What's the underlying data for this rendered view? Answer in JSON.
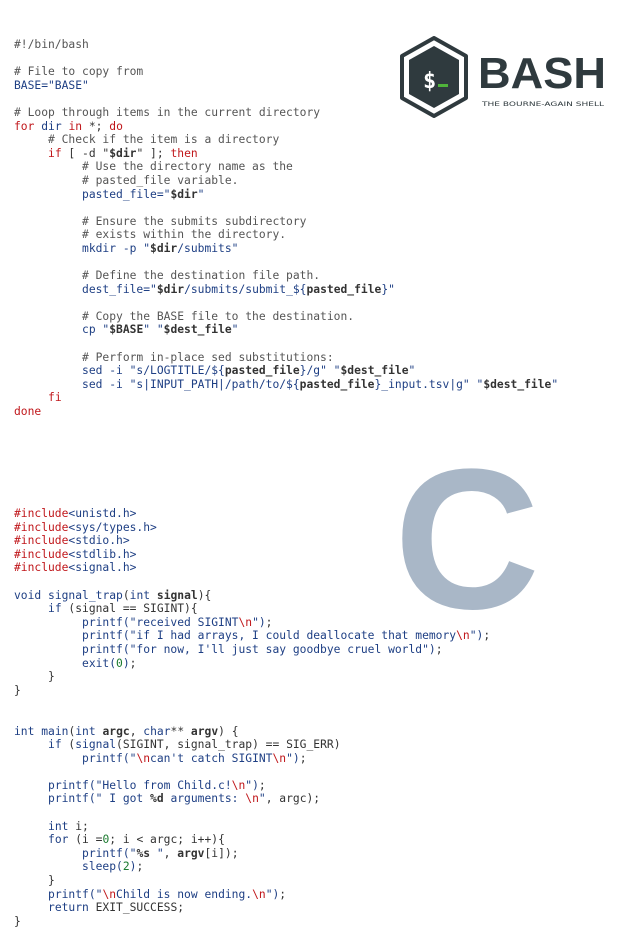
{
  "bash_logo": {
    "wordmark": "BASH",
    "tagline": "THE BOURNE-AGAIN SHELL",
    "prompt_glyph": "$_",
    "color_dark": "#2f3a3e",
    "color_accent": "#4fb33a"
  },
  "c_logo": {
    "letter": "C",
    "color": "#a9b7c7"
  },
  "bash_lines": [
    [
      [
        "cm",
        "#!/bin/bash"
      ]
    ],
    [],
    [
      [
        "cm",
        "# File to copy from"
      ]
    ],
    [
      [
        "st",
        "BASE=\"BASE\""
      ]
    ],
    [],
    [
      [
        "cm",
        "# Loop through items in the current directory"
      ]
    ],
    [
      [
        "kw",
        "for"
      ],
      [
        "pl",
        " "
      ],
      [
        "st",
        "dir"
      ],
      [
        "pl",
        " "
      ],
      [
        "kw",
        "in"
      ],
      [
        "pl",
        " *; "
      ],
      [
        "kw",
        "do"
      ]
    ],
    [
      [
        "pl",
        "     "
      ],
      [
        "cm",
        "# Check if the item is a directory"
      ]
    ],
    [
      [
        "pl",
        "     "
      ],
      [
        "kw",
        "if"
      ],
      [
        "pl",
        " [ -d \""
      ],
      [
        "bo",
        "$dir"
      ],
      [
        "pl",
        "\" ]; "
      ],
      [
        "kw",
        "then"
      ]
    ],
    [
      [
        "pl",
        "          "
      ],
      [
        "cm",
        "# Use the directory name as the"
      ]
    ],
    [
      [
        "pl",
        "          "
      ],
      [
        "cm",
        "# pasted_file variable."
      ]
    ],
    [
      [
        "pl",
        "          "
      ],
      [
        "st",
        "pasted_file=\""
      ],
      [
        "bo",
        "$dir"
      ],
      [
        "st",
        "\""
      ]
    ],
    [],
    [
      [
        "pl",
        "          "
      ],
      [
        "cm",
        "# Ensure the submits subdirectory"
      ]
    ],
    [
      [
        "pl",
        "          "
      ],
      [
        "cm",
        "# exists within the directory."
      ]
    ],
    [
      [
        "pl",
        "          "
      ],
      [
        "st",
        "mkdir -p \""
      ],
      [
        "bo",
        "$dir"
      ],
      [
        "st",
        "/submits\""
      ]
    ],
    [],
    [
      [
        "pl",
        "          "
      ],
      [
        "cm",
        "# Define the destination file path."
      ]
    ],
    [
      [
        "pl",
        "          "
      ],
      [
        "st",
        "dest_file=\""
      ],
      [
        "bo",
        "$dir"
      ],
      [
        "st",
        "/submits/submit_${"
      ],
      [
        "bo",
        "pasted_file"
      ],
      [
        "st",
        "}\""
      ]
    ],
    [],
    [
      [
        "pl",
        "          "
      ],
      [
        "cm",
        "# Copy the BASE file to the destination."
      ]
    ],
    [
      [
        "pl",
        "          "
      ],
      [
        "st",
        "cp \""
      ],
      [
        "bo",
        "$BASE"
      ],
      [
        "st",
        "\" \""
      ],
      [
        "bo",
        "$dest_file"
      ],
      [
        "st",
        "\""
      ]
    ],
    [],
    [
      [
        "pl",
        "          "
      ],
      [
        "cm",
        "# Perform in-place sed substitutions:"
      ]
    ],
    [
      [
        "pl",
        "          "
      ],
      [
        "st",
        "sed -i \"s/LOGTITLE/${"
      ],
      [
        "bo",
        "pasted_file"
      ],
      [
        "st",
        "}/g\" \""
      ],
      [
        "bo",
        "$dest_file"
      ],
      [
        "st",
        "\""
      ]
    ],
    [
      [
        "pl",
        "          "
      ],
      [
        "st",
        "sed -i \"s|INPUT_PATH|/path/to/${"
      ],
      [
        "bo",
        "pasted_file"
      ],
      [
        "st",
        "}_input.tsv|g\" \""
      ],
      [
        "bo",
        "$dest_file"
      ],
      [
        "st",
        "\""
      ]
    ],
    [
      [
        "pl",
        "     "
      ],
      [
        "kw",
        "fi"
      ]
    ],
    [
      [
        "kw",
        "done"
      ]
    ]
  ],
  "c_lines": [
    [
      [
        "kw",
        "#include"
      ],
      [
        "st",
        "<unistd.h>"
      ]
    ],
    [
      [
        "kw",
        "#include"
      ],
      [
        "st",
        "<sys/types.h>"
      ]
    ],
    [
      [
        "kw",
        "#include"
      ],
      [
        "st",
        "<stdio.h>"
      ]
    ],
    [
      [
        "kw",
        "#include"
      ],
      [
        "st",
        "<stdlib.h>"
      ]
    ],
    [
      [
        "kw",
        "#include"
      ],
      [
        "st",
        "<signal.h>"
      ]
    ],
    [],
    [
      [
        "ty",
        "void"
      ],
      [
        "pl",
        " "
      ],
      [
        "st",
        "signal_trap"
      ],
      [
        "pl",
        "("
      ],
      [
        "ty",
        "int"
      ],
      [
        "pl",
        " "
      ],
      [
        "bo",
        "signal"
      ],
      [
        "pl",
        "){"
      ]
    ],
    [
      [
        "pl",
        "     "
      ],
      [
        "ty",
        "if"
      ],
      [
        "pl",
        " (signal == SIGINT){"
      ]
    ],
    [
      [
        "pl",
        "          "
      ],
      [
        "st",
        "printf(\"received SIGINT"
      ],
      [
        "es",
        "\\n"
      ],
      [
        "st",
        "\")"
      ],
      [
        "pl",
        ";"
      ]
    ],
    [
      [
        "pl",
        "          "
      ],
      [
        "st",
        "printf(\"if I had arrays, I could deallocate that memory"
      ],
      [
        "es",
        "\\n"
      ],
      [
        "st",
        "\")"
      ],
      [
        "pl",
        ";"
      ]
    ],
    [
      [
        "pl",
        "          "
      ],
      [
        "st",
        "printf(\"for now, I'll just say goodbye cruel world\")"
      ],
      [
        "pl",
        ";"
      ]
    ],
    [
      [
        "pl",
        "          "
      ],
      [
        "st",
        "exit("
      ],
      [
        "nu",
        "0"
      ],
      [
        "st",
        ")"
      ],
      [
        "pl",
        ";"
      ]
    ],
    [
      [
        "pl",
        "     }"
      ]
    ],
    [
      [
        "pl",
        "}"
      ]
    ],
    [],
    [],
    [
      [
        "ty",
        "int"
      ],
      [
        "pl",
        " "
      ],
      [
        "st",
        "main"
      ],
      [
        "pl",
        "("
      ],
      [
        "ty",
        "int"
      ],
      [
        "pl",
        " "
      ],
      [
        "bo",
        "argc"
      ],
      [
        "pl",
        ", "
      ],
      [
        "ty",
        "char"
      ],
      [
        "pl",
        "** "
      ],
      [
        "bo",
        "argv"
      ],
      [
        "pl",
        ") {"
      ]
    ],
    [
      [
        "pl",
        "     "
      ],
      [
        "ty",
        "if"
      ],
      [
        "pl",
        " ("
      ],
      [
        "st",
        "signal"
      ],
      [
        "pl",
        "(SIGINT, signal_trap) == SIG_ERR)"
      ]
    ],
    [
      [
        "pl",
        "          "
      ],
      [
        "st",
        "printf(\""
      ],
      [
        "es",
        "\\n"
      ],
      [
        "st",
        "can't catch SIGINT"
      ],
      [
        "es",
        "\\n"
      ],
      [
        "st",
        "\")"
      ],
      [
        "pl",
        ";"
      ]
    ],
    [],
    [
      [
        "pl",
        "     "
      ],
      [
        "st",
        "printf(\"Hello from Child.c!"
      ],
      [
        "es",
        "\\n"
      ],
      [
        "st",
        "\")"
      ],
      [
        "pl",
        ";"
      ]
    ],
    [
      [
        "pl",
        "     "
      ],
      [
        "st",
        "printf(\" I got "
      ],
      [
        "bo",
        "%d"
      ],
      [
        "st",
        " arguments: "
      ],
      [
        "es",
        "\\n"
      ],
      [
        "st",
        "\""
      ],
      [
        "pl",
        ", argc);"
      ]
    ],
    [],
    [
      [
        "pl",
        "     "
      ],
      [
        "ty",
        "int"
      ],
      [
        "pl",
        " i;"
      ]
    ],
    [
      [
        "pl",
        "     "
      ],
      [
        "ty",
        "for"
      ],
      [
        "pl",
        " (i ="
      ],
      [
        "nu",
        "0"
      ],
      [
        "pl",
        "; i < argc; i++){"
      ]
    ],
    [
      [
        "pl",
        "          "
      ],
      [
        "st",
        "printf(\""
      ],
      [
        "bo",
        "%s"
      ],
      [
        "st",
        " \""
      ],
      [
        "pl",
        ", "
      ],
      [
        "bo",
        "argv"
      ],
      [
        "pl",
        "[i]);"
      ]
    ],
    [
      [
        "pl",
        "          "
      ],
      [
        "st",
        "sleep("
      ],
      [
        "nu",
        "2"
      ],
      [
        "st",
        ")"
      ],
      [
        "pl",
        ";"
      ]
    ],
    [
      [
        "pl",
        "     }"
      ]
    ],
    [
      [
        "pl",
        "     "
      ],
      [
        "st",
        "printf(\""
      ],
      [
        "es",
        "\\n"
      ],
      [
        "st",
        "Child is now ending."
      ],
      [
        "es",
        "\\n"
      ],
      [
        "st",
        "\")"
      ],
      [
        "pl",
        ";"
      ]
    ],
    [
      [
        "pl",
        "     "
      ],
      [
        "ty",
        "return"
      ],
      [
        "pl",
        " EXIT_SUCCESS;"
      ]
    ],
    [
      [
        "pl",
        "}"
      ]
    ]
  ]
}
